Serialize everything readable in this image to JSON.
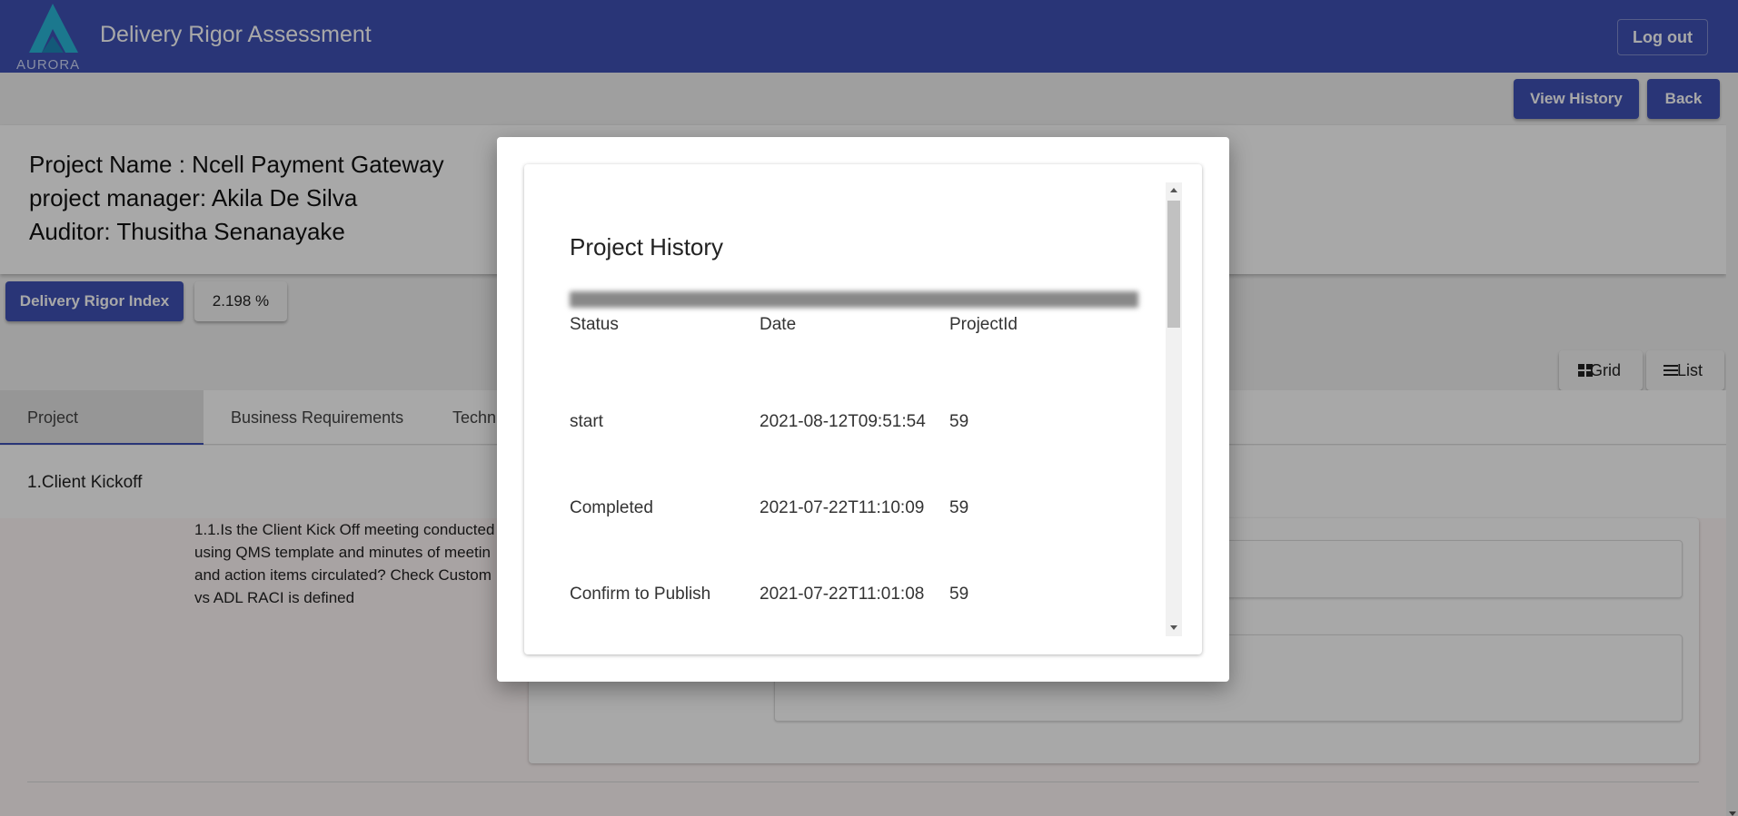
{
  "app": {
    "title": "Delivery Rigor Assessment",
    "logo_text": "AURORA",
    "logout_label": "Log out",
    "brand_color": "#3f51b5"
  },
  "actions": {
    "view_history_label": "View History",
    "back_label": "Back"
  },
  "project": {
    "name_line": "Project Name : Ncell Payment Gateway",
    "manager_line": "project manager: Akila De Silva",
    "auditor_line": "Auditor: Thusitha Senanayake"
  },
  "index": {
    "label": "Delivery Rigor Index",
    "value": "2.198 %"
  },
  "view_toggle": {
    "grid_label": "Grid",
    "list_label": "List"
  },
  "tabs": [
    {
      "label": "Project Management",
      "active": true
    },
    {
      "label": "Business Requirements",
      "active": false
    },
    {
      "label": "Techn",
      "active": false
    }
  ],
  "section": {
    "title": "1.Client Kickoff",
    "question": "1.1.Is the Client Kick Off meeting conducted\nusing QMS template and minutes of meetin\nand action items circulated? Check Custom\nvs ADL RACI is defined"
  },
  "modal": {
    "title": "Project History",
    "columns": [
      "Status",
      "Date",
      "ProjectId"
    ],
    "rows": [
      {
        "status": "start",
        "date": "2021-08-12T09:51:54",
        "project_id": "59"
      },
      {
        "status": "Completed",
        "date": "2021-07-22T11:10:09",
        "project_id": "59"
      },
      {
        "status": "Confirm to Publish",
        "date": "2021-07-22T11:01:08",
        "project_id": "59"
      }
    ]
  }
}
